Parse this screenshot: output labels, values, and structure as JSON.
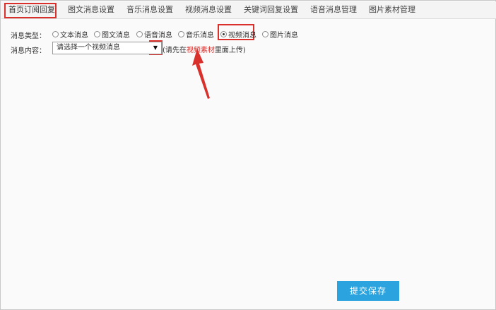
{
  "tabs": [
    {
      "label": "首页订阅回复",
      "active": true
    },
    {
      "label": "图文消息设置"
    },
    {
      "label": "音乐消息设置"
    },
    {
      "label": "视频消息设置"
    },
    {
      "label": "关键词回复设置"
    },
    {
      "label": "语音消息管理"
    },
    {
      "label": "图片素材管理"
    }
  ],
  "form": {
    "type_label": "消息类型：",
    "content_label": "消息内容：",
    "types": [
      {
        "label": "文本消息",
        "checked": false
      },
      {
        "label": "图文消息",
        "checked": false
      },
      {
        "label": "语音消息",
        "checked": false
      },
      {
        "label": "音乐消息",
        "checked": false
      },
      {
        "label": "视频消息",
        "checked": true
      },
      {
        "label": "图片消息",
        "checked": false
      }
    ],
    "select_value": "请选择一个视频消息",
    "select_arrow": "▼",
    "hint_prefix": "(请先在",
    "hint_link": "视频素材",
    "hint_suffix": "里面上传)"
  },
  "submit_label": "提交保存",
  "colors": {
    "highlight": "#d9302c",
    "button": "#2aa3df",
    "link": "#d9302c"
  }
}
